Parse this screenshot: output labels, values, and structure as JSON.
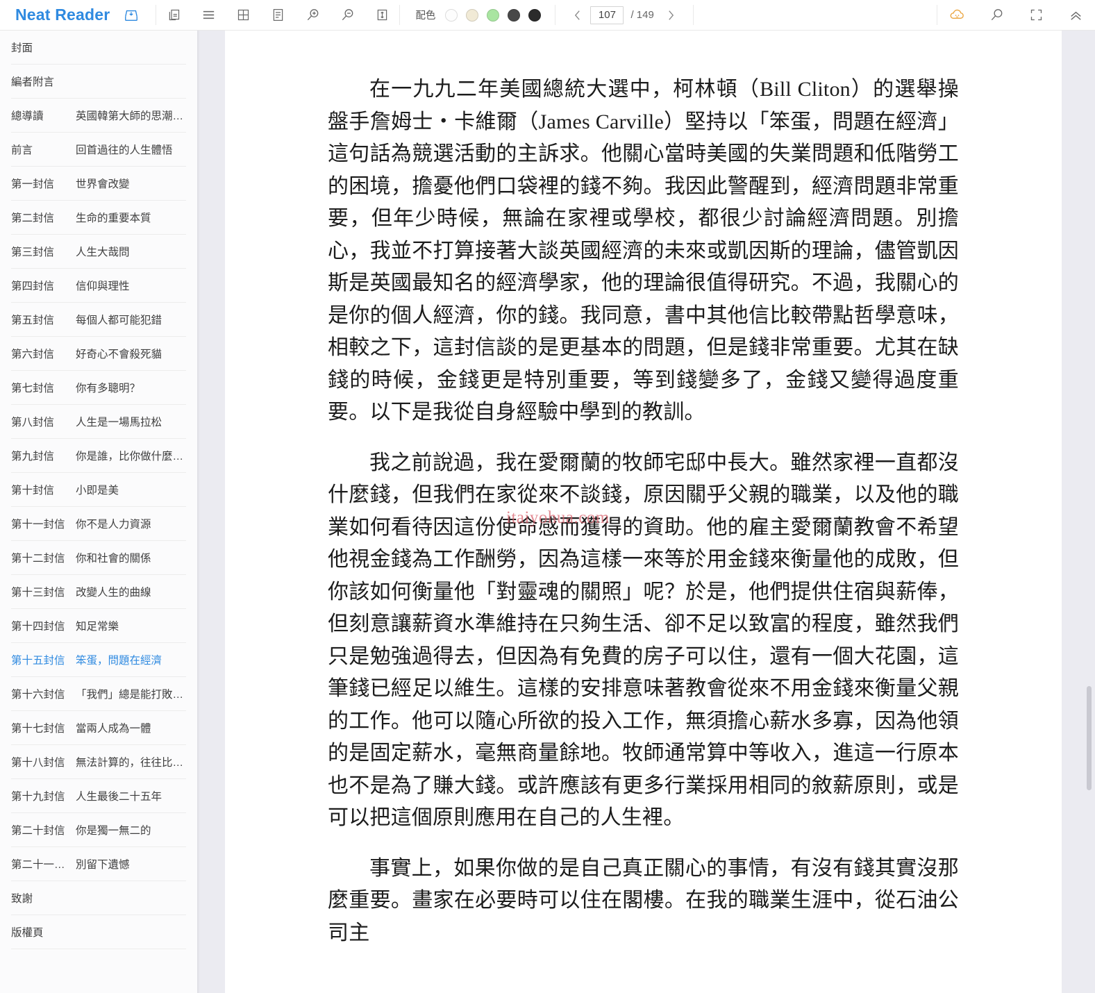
{
  "app": {
    "brand": "Neat Reader"
  },
  "toolbar": {
    "icons": [
      {
        "name": "save-to-shelf-icon",
        "label": "save-to-shelf"
      },
      {
        "name": "copy-icon",
        "label": "copy"
      },
      {
        "name": "hamburger-menu-icon",
        "label": "contents"
      },
      {
        "name": "grid-layout-icon",
        "label": "grid-layout"
      },
      {
        "name": "note-icon",
        "label": "notes"
      },
      {
        "name": "zoom-in-icon",
        "label": "zoom-in"
      },
      {
        "name": "zoom-out-icon",
        "label": "zoom-out"
      },
      {
        "name": "line-spacing-icon",
        "label": "line-spacing"
      }
    ],
    "palette_label": "配色",
    "palette_swatches": [
      {
        "name": "theme-white",
        "color": "#fdfdfd"
      },
      {
        "name": "theme-sepia",
        "color": "#f1ead6"
      },
      {
        "name": "theme-green",
        "color": "#a9e5a1"
      },
      {
        "name": "theme-dark-gray",
        "color": "#484848"
      },
      {
        "name": "theme-black",
        "color": "#2b2b2b"
      }
    ],
    "pager": {
      "prev": "‹",
      "next": "›",
      "current_page": "107",
      "total_pages": "/ 149"
    },
    "right_icons": [
      {
        "name": "cloud-sync-icon",
        "label": "cloud-sync",
        "color": "#eaa33c"
      },
      {
        "name": "search-icon",
        "label": "search"
      },
      {
        "name": "fullscreen-icon",
        "label": "fullscreen"
      },
      {
        "name": "collapse-toolbar-icon",
        "label": "collapse"
      }
    ]
  },
  "sidebar": {
    "items": [
      {
        "num": "封面",
        "title": "",
        "active": false
      },
      {
        "num": "編者附言",
        "title": "",
        "active": false
      },
      {
        "num": "總導讀",
        "title": "英國韓第大師的思潮縮…",
        "active": false
      },
      {
        "num": "前言",
        "title": "回首過往的人生體悟",
        "active": false
      },
      {
        "num": "第一封信",
        "title": "世界會改變",
        "active": false
      },
      {
        "num": "第二封信",
        "title": "生命的重要本質",
        "active": false
      },
      {
        "num": "第三封信",
        "title": "人生大哉問",
        "active": false
      },
      {
        "num": "第四封信",
        "title": "信仰與理性",
        "active": false
      },
      {
        "num": "第五封信",
        "title": "每個人都可能犯錯",
        "active": false
      },
      {
        "num": "第六封信",
        "title": "好奇心不會殺死貓",
        "active": false
      },
      {
        "num": "第七封信",
        "title": "你有多聰明？",
        "active": false
      },
      {
        "num": "第八封信",
        "title": "人生是一場馬拉松",
        "active": false
      },
      {
        "num": "第九封信",
        "title": "你是誰，比你做什麼更…",
        "active": false
      },
      {
        "num": "第十封信",
        "title": "小即是美",
        "active": false
      },
      {
        "num": "第十一封信",
        "title": "你不是人力資源",
        "active": false
      },
      {
        "num": "第十二封信",
        "title": "你和社會的關係",
        "active": false
      },
      {
        "num": "第十三封信",
        "title": "改變人生的曲線",
        "active": false
      },
      {
        "num": "第十四封信",
        "title": "知足常樂",
        "active": false
      },
      {
        "num": "第十五封信",
        "title": "笨蛋，問題在經濟",
        "active": true
      },
      {
        "num": "第十六封信",
        "title": "「我們」總是能打敗「我」",
        "active": false
      },
      {
        "num": "第十七封信",
        "title": "當兩人成為一體",
        "active": false
      },
      {
        "num": "第十八封信",
        "title": "無法計算的，往往比可…",
        "active": false
      },
      {
        "num": "第十九封信",
        "title": "人生最後二十五年",
        "active": false
      },
      {
        "num": "第二十封信",
        "title": "你是獨一無二的",
        "active": false
      },
      {
        "num": "第二十一封信",
        "title": "別留下遺憾",
        "active": false
      },
      {
        "num": "致謝",
        "title": "",
        "active": false
      },
      {
        "num": "版權頁",
        "title": "",
        "active": false
      }
    ]
  },
  "content": {
    "paragraphs": [
      "在一九九二年美國總統大選中，柯林頓（Bill Cliton）的選舉操盤手詹姆士・卡維爾（James Carville）堅持以「笨蛋，問題在經濟」這句話為競選活動的主訴求。他關心當時美國的失業問題和低階勞工的困境，擔憂他們口袋裡的錢不夠。我因此警醒到，經濟問題非常重要，但年少時候，無論在家裡或學校，都很少討論經濟問題。別擔心，我並不打算接著大談英國經濟的未來或凱因斯的理論，儘管凱因斯是英國最知名的經濟學家，他的理論很值得研究。不過，我關心的是你的個人經濟，你的錢。我同意，書中其他信比較帶點哲學意味，相較之下，這封信談的是更基本的問題，但是錢非常重要。尤其在缺錢的時候，金錢更是特別重要，等到錢變多了，金錢又變得過度重要。以下是我從自身經驗中學到的教訓。",
      "我之前說過，我在愛爾蘭的牧師宅邸中長大。雖然家裡一直都沒什麼錢，但我們在家從來不談錢，原因關乎父親的職業，以及他的職業如何看待因這份使命感而獲得的資助。他的雇主愛爾蘭教會不希望他視金錢為工作酬勞，因為這樣一來等於用金錢來衡量他的成敗，但你該如何衡量他「對靈魂的關照」呢？於是，他們提供住宿與薪俸，但刻意讓薪資水準維持在只夠生活、卻不足以致富的程度，雖然我們只是勉強過得去，但因為有免費的房子可以住，還有一個大花園，這筆錢已經足以維生。這樣的安排意味著教會從來不用金錢來衡量父親的工作。他可以隨心所欲的投入工作，無須擔心薪水多寡，因為他領的是固定薪水，毫無商量餘地。牧師通常算中等收入，進這一行原本也不是為了賺大錢。或許應該有更多行業採用相同的敘薪原則，或是可以把這個原則應用在自己的人生裡。",
      "事實上，如果你做的是自己真正關心的事情，有沒有錢其實沒那麼重要。畫家在必要時可以住在閣樓。在我的職業生涯中，從石油公司主"
    ],
    "watermark": "itaiyohua.com"
  }
}
